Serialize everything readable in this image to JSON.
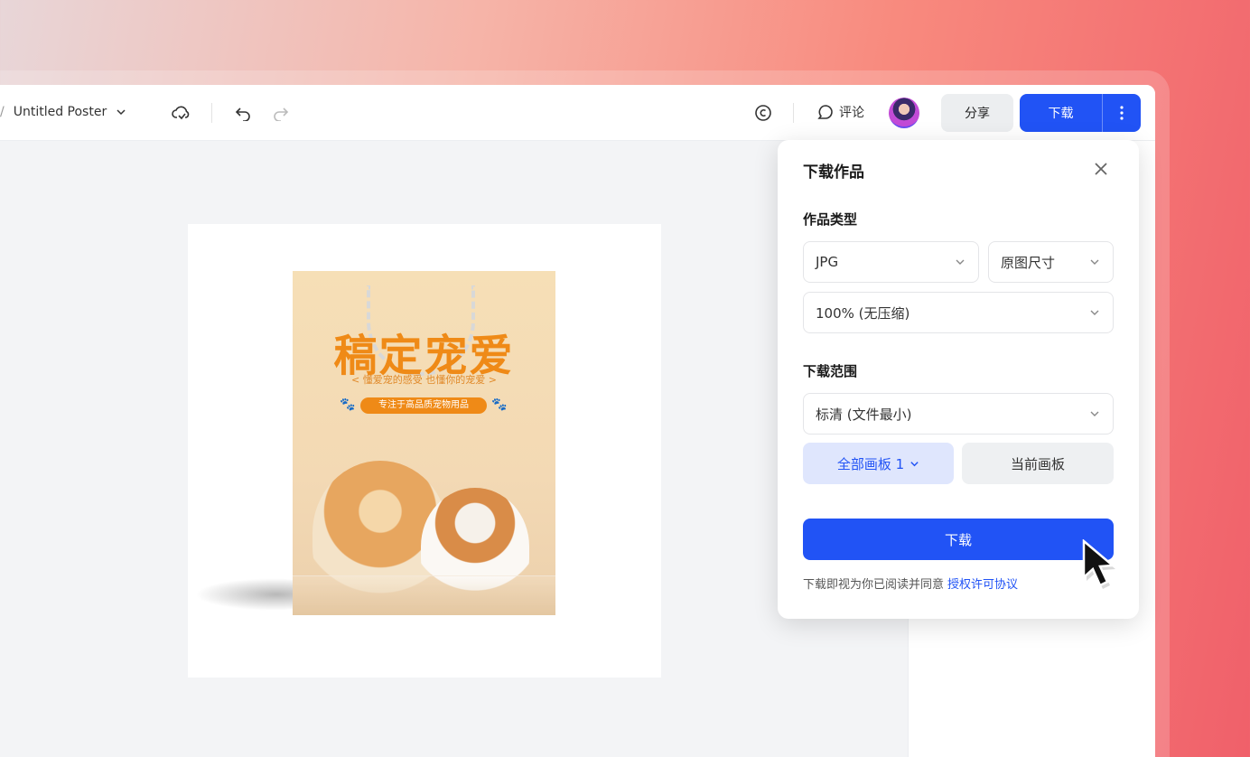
{
  "topbar": {
    "breadcrumb_sep": "/",
    "doc_title": "Untitled Poster",
    "comment_label": "评论",
    "share_label": "分享",
    "download_label": "下载"
  },
  "poster": {
    "headline": "稿定宠爱",
    "subline": "< 懂爱宠的感受 也懂你的宠爱 >",
    "pill": "专注于高品质宠物用品"
  },
  "download_panel": {
    "title": "下载作品",
    "type_label": "作品类型",
    "format_value": "JPG",
    "size_value": "原图尺寸",
    "quality_value": "100% (无压缩)",
    "range_label": "下载范围",
    "resolution_value": "标清 (文件最小)",
    "all_boards_label": "全部画板 1",
    "current_board_label": "当前画板",
    "download_button": "下载",
    "agreement_text": "下载即视为你已阅读并同意",
    "agreement_link": "授权许可协议"
  },
  "colors": {
    "primary": "#2153f5",
    "poster_orange": "#ef8a17"
  }
}
